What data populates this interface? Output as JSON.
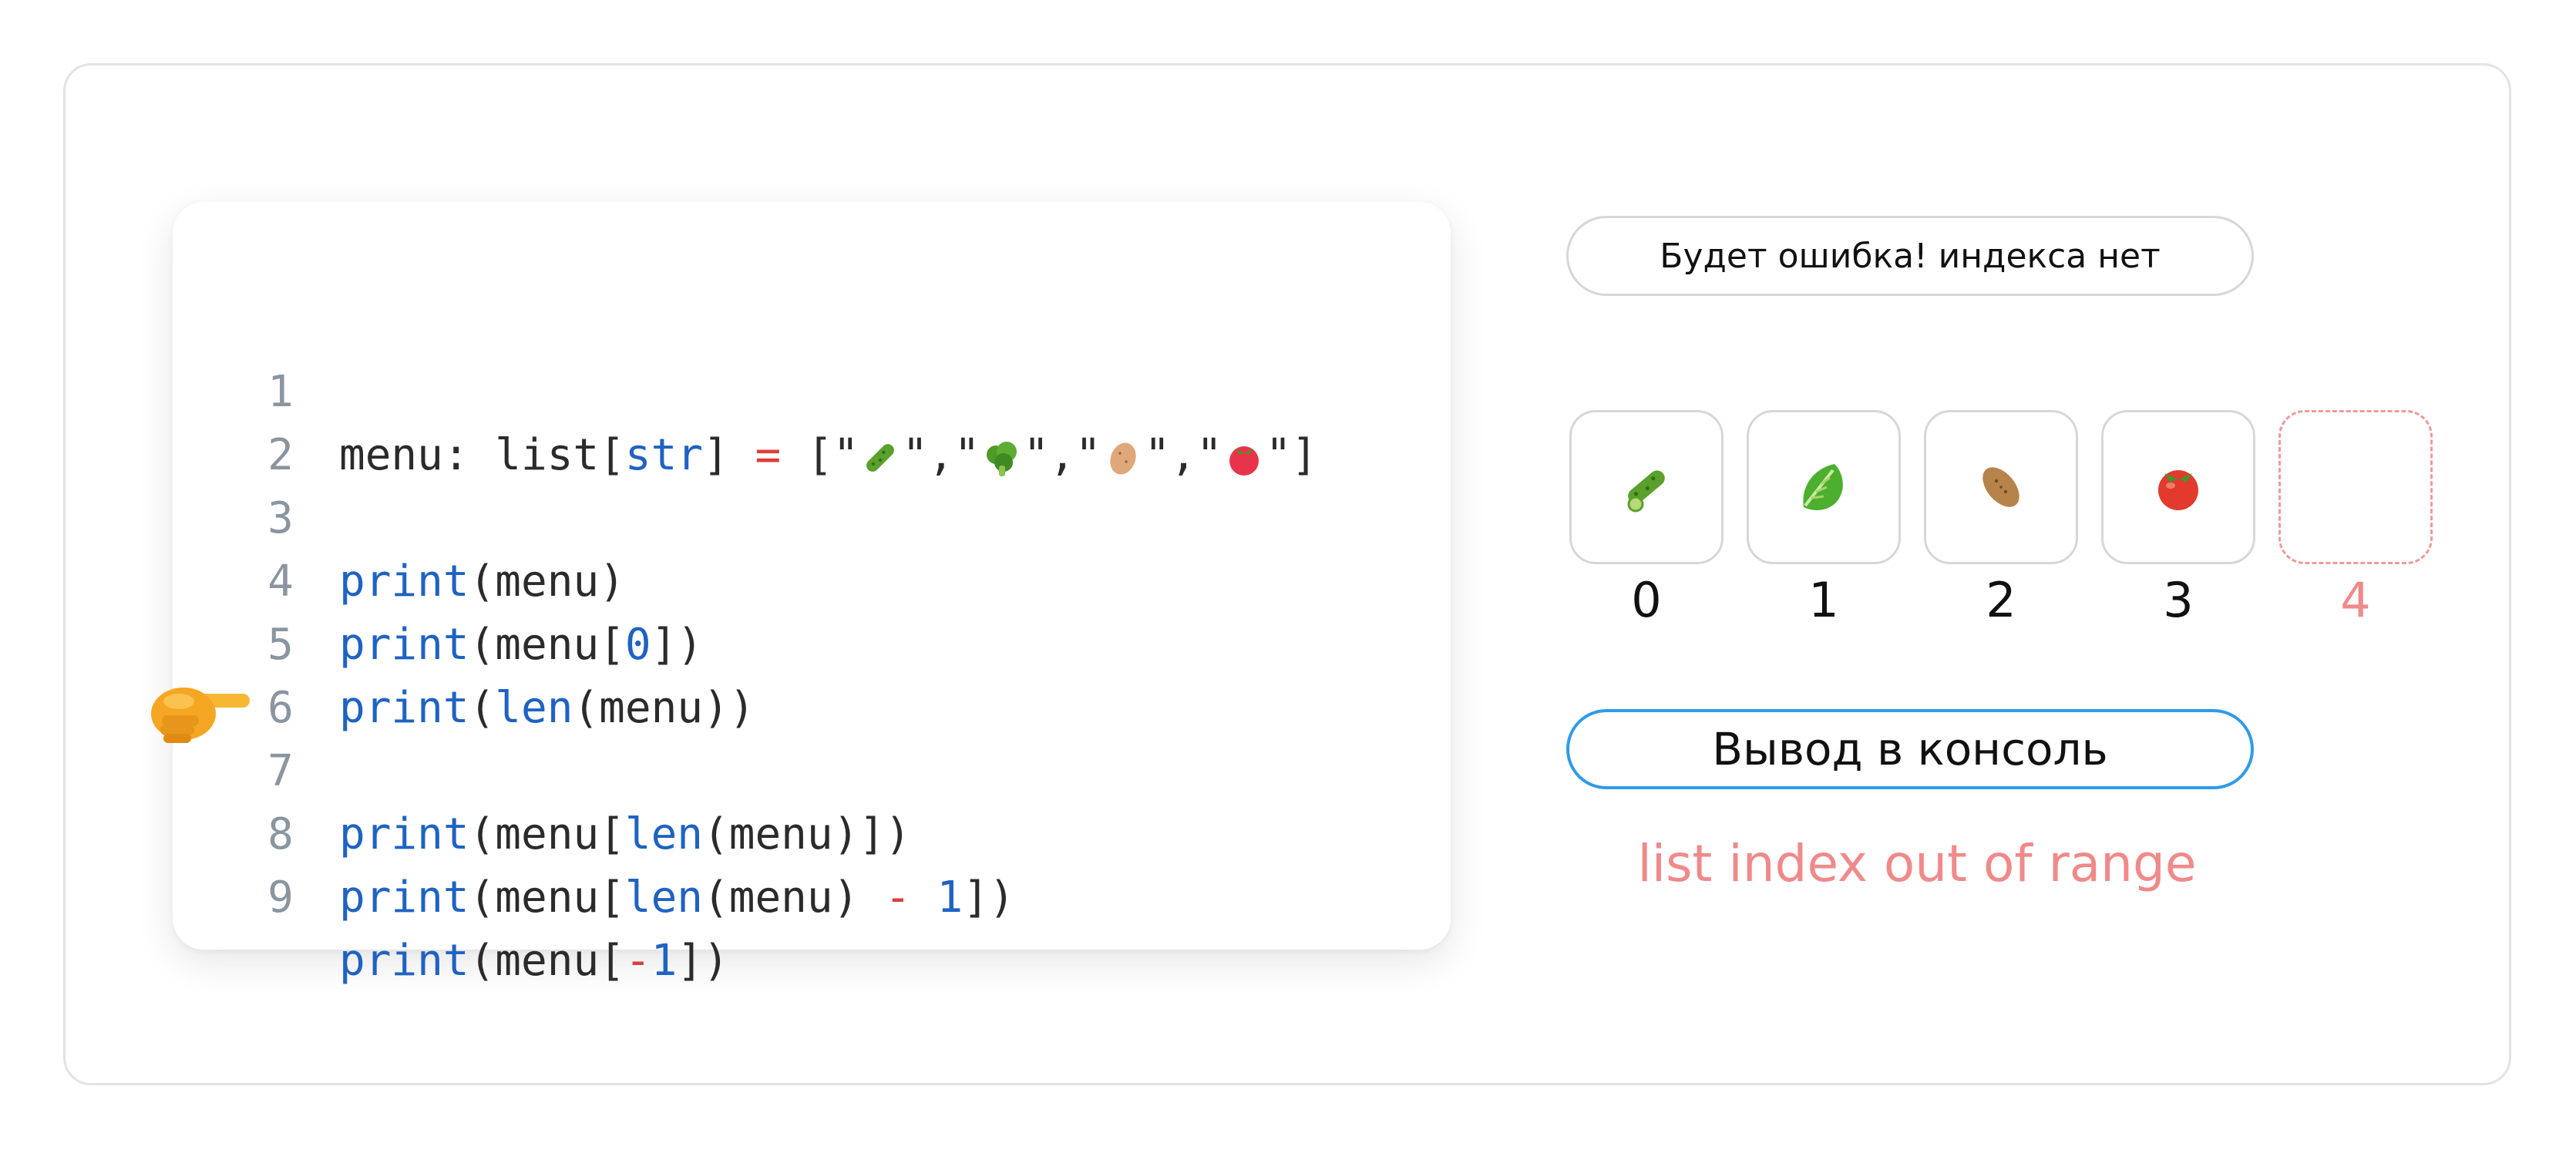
{
  "code": {
    "lines": [
      {
        "n": "1"
      },
      {
        "n": "2"
      },
      {
        "n": "3"
      },
      {
        "n": "4"
      },
      {
        "n": "5"
      },
      {
        "n": "6"
      },
      {
        "n": "7"
      },
      {
        "n": "8"
      },
      {
        "n": "9"
      }
    ],
    "l1": {
      "a": "menu: list[",
      "str": "str",
      "b": "] ",
      "eq": "=",
      "c": " [\"",
      "sep1": "\",\"",
      "sep2": "\",\"",
      "sep3": "\",\"",
      "end": "\"]"
    },
    "print": "print",
    "len": "len",
    "menu": "menu",
    "l3_rest": "(menu)",
    "l4_a": "(menu[",
    "l4_n": "0",
    "l4_b": "])",
    "l5_a": "(",
    "l5_b": "(menu))",
    "l7_a": "(menu[",
    "l7_b": "(menu)])",
    "l8_a": "(menu[",
    "l8_b": "(menu) ",
    "l8_op": "-",
    "l8_sp": " ",
    "l8_n": "1",
    "l8_c": "])",
    "l9_a": "(menu[",
    "l9_op": "-",
    "l9_n": "1",
    "l9_b": "])"
  },
  "hint_label": "Будет ошибка! индекса нет",
  "cells": [
    {
      "icon": "cucumber-icon",
      "index": "0"
    },
    {
      "icon": "lettuce-icon",
      "index": "1"
    },
    {
      "icon": "potato-icon",
      "index": "2"
    },
    {
      "icon": "tomato-icon",
      "index": "3"
    },
    {
      "icon": "empty",
      "index": "4"
    }
  ],
  "output_button": "Вывод в консоль",
  "error_text": "list index out of range",
  "colors": {
    "keyword": "#1f63c2",
    "operator": "#d9403a",
    "error": "#f08a8a",
    "output_border": "#2f9be8"
  }
}
